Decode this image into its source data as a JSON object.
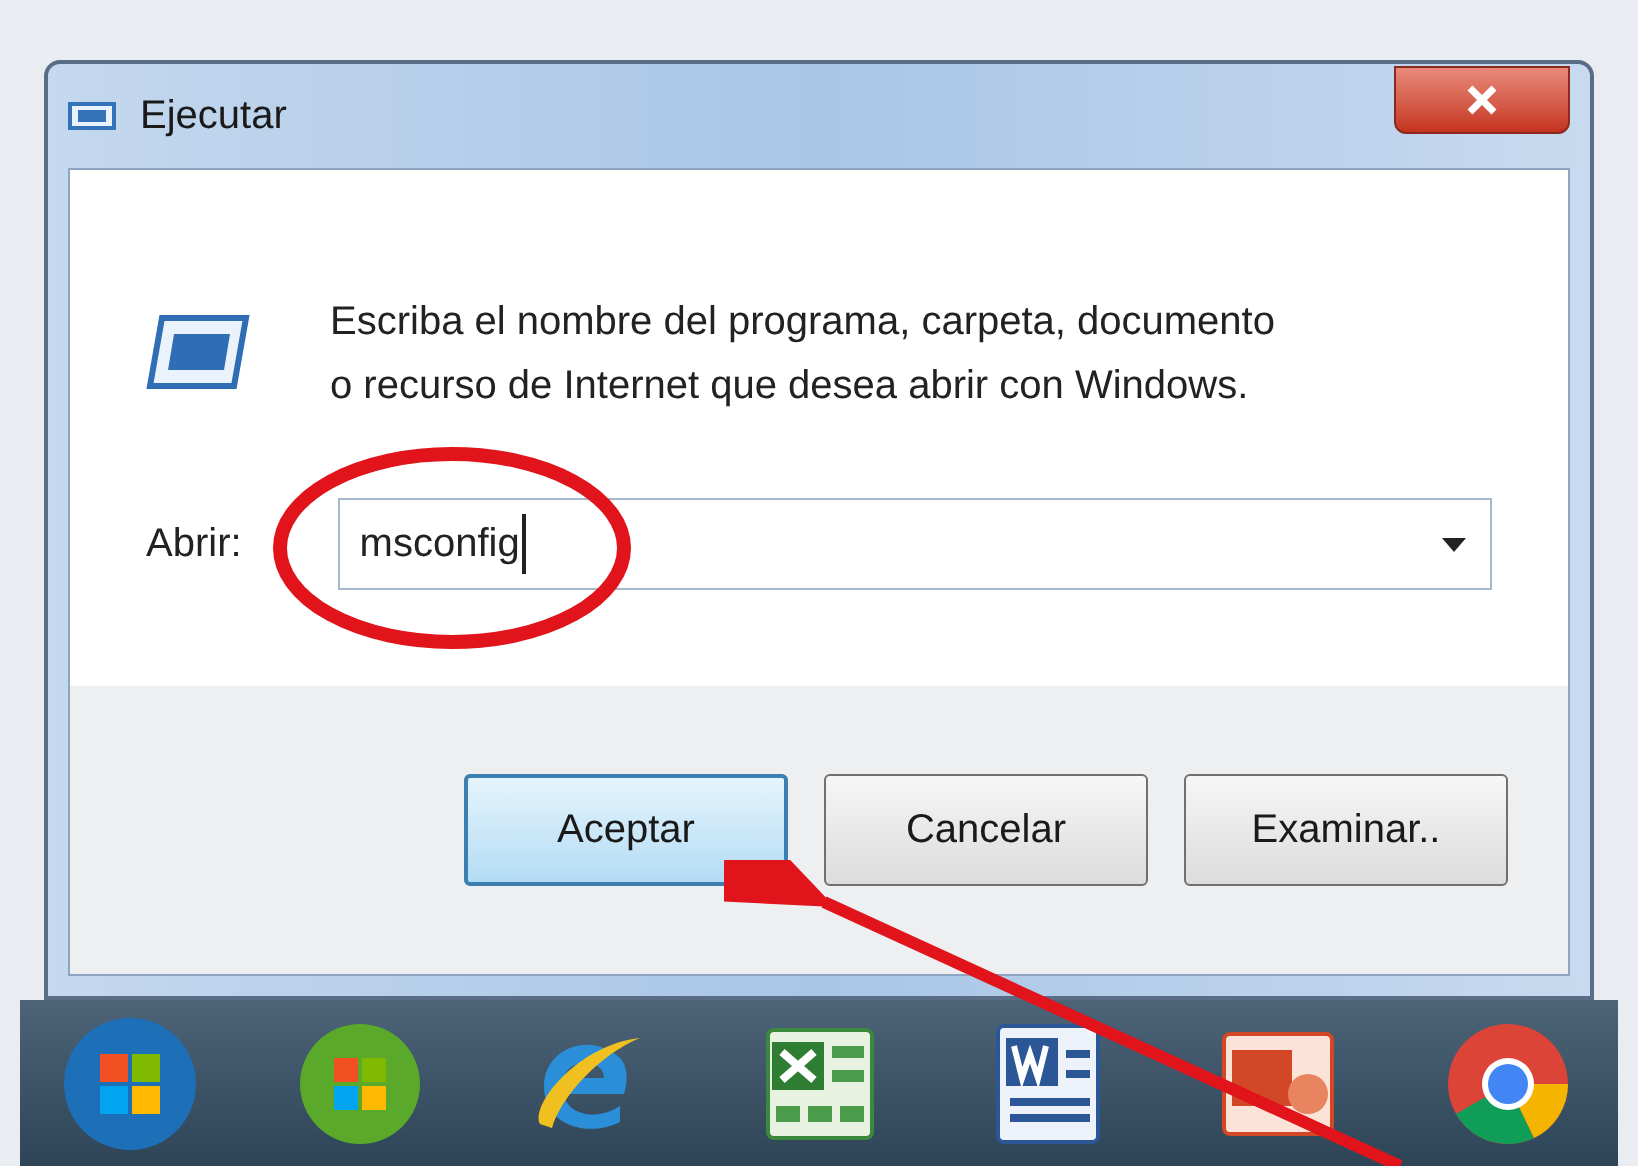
{
  "window": {
    "title": "Ejecutar"
  },
  "message": {
    "line_1": "Escriba el nombre del programa, carpeta, documento",
    "line_2": "o recurso de Internet que desea abrir con Windows."
  },
  "open_field": {
    "label": "Abrir:",
    "value": "msconfig"
  },
  "buttons": [
    {
      "label": "Aceptar",
      "selected": true
    },
    {
      "label": "Cancelar",
      "selected": false
    },
    {
      "label": "Examinar..",
      "selected": false
    }
  ],
  "annotations": {
    "circle": true,
    "arrow": true
  },
  "taskbar": {
    "icons": [
      {
        "kind": "start"
      },
      {
        "kind": "media"
      },
      {
        "kind": "browser"
      },
      {
        "kind": "sheet"
      },
      {
        "kind": "doc"
      },
      {
        "kind": "slides"
      },
      {
        "kind": "chrome"
      }
    ]
  }
}
